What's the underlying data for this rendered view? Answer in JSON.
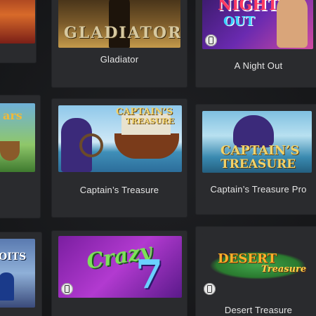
{
  "games": [
    {
      "id": "gladiator",
      "title": "Gladiator",
      "logo_text": "GLADIATOR"
    },
    {
      "id": "night_out",
      "title": "A Night Out",
      "logo_text_1": "NIGHT",
      "logo_text_2": "OUT"
    },
    {
      "id": "captains_treasure",
      "title": "Captain’s Treasure",
      "logo_text_1": "CAPTAIN’S",
      "logo_text_2": "TREASURE"
    },
    {
      "id": "captains_treasure_pro",
      "title": "Captain’s Treasure Pro",
      "logo_text_1": "CAPTAIN’S",
      "logo_text_2": "TREASURE"
    },
    {
      "id": "crazy_7",
      "title": "",
      "logo_text": "Crazy"
    },
    {
      "id": "desert_treasure",
      "title": "Desert Treasure",
      "logo_text_1": "DESERT",
      "logo_text_2": "Treasure"
    },
    {
      "id": "partial_left_bottom",
      "title": "",
      "logo_text": "OITS"
    }
  ],
  "colors": {
    "card": "#2a2b2e",
    "background": "#17181a",
    "title": "#e6e6e6"
  }
}
